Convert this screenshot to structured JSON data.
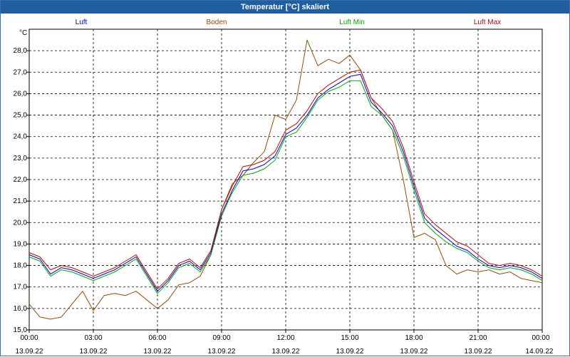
{
  "window": {
    "title": "Temperatur [°C] skaliert"
  },
  "chart_data": {
    "type": "line",
    "title": "Temperatur [°C] skaliert",
    "ylabel": "°C",
    "ylim": [
      15.0,
      29.0
    ],
    "yticks": [
      "15,0",
      "16,0",
      "17,0",
      "18,0",
      "19,0",
      "20,0",
      "21,0",
      "22,0",
      "23,0",
      "24,0",
      "25,0",
      "26,0",
      "27,0",
      "28,0"
    ],
    "xlim": [
      0,
      24
    ],
    "xticks": [
      {
        "h": 0,
        "time": "00:00",
        "date": "13.09.22"
      },
      {
        "h": 3,
        "time": "03:00",
        "date": "13.09.22"
      },
      {
        "h": 6,
        "time": "06:00",
        "date": "13.09.22"
      },
      {
        "h": 9,
        "time": "09:00",
        "date": "13.09.22"
      },
      {
        "h": 12,
        "time": "12:00",
        "date": "13.09.22"
      },
      {
        "h": 15,
        "time": "15:00",
        "date": "13.09.22"
      },
      {
        "h": 18,
        "time": "18:00",
        "date": "13.09.22"
      },
      {
        "h": 21,
        "time": "21:00",
        "date": "13.09.22"
      },
      {
        "h": 24,
        "time": "00:00",
        "date": "14.09.22"
      }
    ],
    "grid": true,
    "legend_position": "top",
    "x": [
      0,
      0.5,
      1.0,
      1.5,
      2.0,
      2.5,
      3.0,
      3.5,
      4.0,
      4.5,
      5.0,
      5.5,
      6.0,
      6.5,
      7.0,
      7.5,
      8.0,
      8.5,
      9.0,
      9.5,
      10.0,
      10.5,
      11.0,
      11.5,
      12.0,
      12.5,
      13.0,
      13.5,
      14.0,
      14.5,
      15.0,
      15.5,
      16.0,
      16.5,
      17.0,
      17.5,
      18.0,
      18.5,
      19.0,
      19.5,
      20.0,
      20.5,
      21.0,
      21.5,
      22.0,
      22.5,
      23.0,
      23.5,
      24.0
    ],
    "series": [
      {
        "name": "Luft",
        "color": "#0000cc",
        "values": [
          18.5,
          18.3,
          17.6,
          17.9,
          17.8,
          17.6,
          17.4,
          17.6,
          17.8,
          18.1,
          18.4,
          17.6,
          16.8,
          17.3,
          18.0,
          18.2,
          17.8,
          18.6,
          20.4,
          21.5,
          22.4,
          22.5,
          22.7,
          23.1,
          24.1,
          24.4,
          25.0,
          25.8,
          26.2,
          26.5,
          26.8,
          26.9,
          25.6,
          25.1,
          24.5,
          23.3,
          21.7,
          20.2,
          19.7,
          19.3,
          18.9,
          18.7,
          18.3,
          18.0,
          17.9,
          18.0,
          17.9,
          17.7,
          17.4
        ]
      },
      {
        "name": "Boden",
        "color": "#994c00",
        "values": [
          16.2,
          15.6,
          15.5,
          15.6,
          16.2,
          16.8,
          15.9,
          16.6,
          16.7,
          16.6,
          16.8,
          16.4,
          16.0,
          16.4,
          17.1,
          17.2,
          17.5,
          18.5,
          20.6,
          21.8,
          22.2,
          22.8,
          23.3,
          25.0,
          24.8,
          25.7,
          28.5,
          27.3,
          27.6,
          27.4,
          27.8,
          27.1,
          25.8,
          25.0,
          24.3,
          22.0,
          19.3,
          19.5,
          19.2,
          18.0,
          17.6,
          17.8,
          17.7,
          17.8,
          17.6,
          17.7,
          17.4,
          17.3,
          17.2
        ]
      },
      {
        "name": "Luft Min",
        "color": "#00aa00",
        "values": [
          18.4,
          18.2,
          17.5,
          17.8,
          17.7,
          17.5,
          17.3,
          17.5,
          17.7,
          18.0,
          18.3,
          17.5,
          16.7,
          17.2,
          17.9,
          18.1,
          17.7,
          18.5,
          20.3,
          21.4,
          22.2,
          22.3,
          22.5,
          22.9,
          24.0,
          24.2,
          24.9,
          25.7,
          26.1,
          26.3,
          26.6,
          26.6,
          25.4,
          25.0,
          24.3,
          23.1,
          21.5,
          20.0,
          19.5,
          19.1,
          18.8,
          18.6,
          18.2,
          17.9,
          17.8,
          17.9,
          17.8,
          17.6,
          17.3
        ]
      },
      {
        "name": "Luft Max",
        "color": "#cc0000",
        "values": [
          18.6,
          18.4,
          17.8,
          18.0,
          17.9,
          17.7,
          17.5,
          17.7,
          17.9,
          18.2,
          18.5,
          17.7,
          16.9,
          17.4,
          18.1,
          18.3,
          17.9,
          18.7,
          20.6,
          21.7,
          22.6,
          22.7,
          22.9,
          23.3,
          24.3,
          24.6,
          25.2,
          26.0,
          26.4,
          26.7,
          27.0,
          27.1,
          25.8,
          25.3,
          24.7,
          23.5,
          21.9,
          20.4,
          19.9,
          19.5,
          19.1,
          18.9,
          18.5,
          18.1,
          18.0,
          18.1,
          18.0,
          17.8,
          17.5
        ]
      }
    ]
  }
}
